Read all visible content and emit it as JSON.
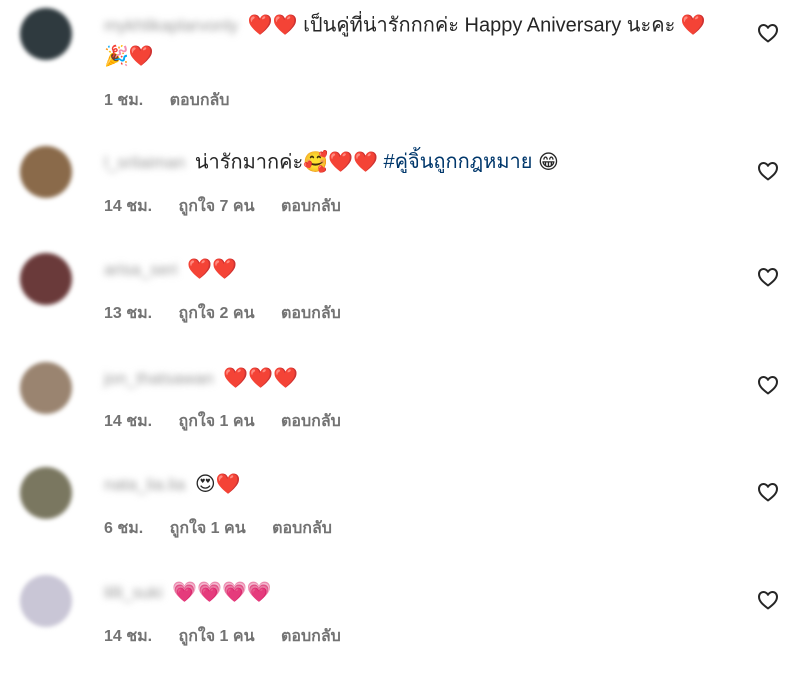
{
  "comments": [
    {
      "username": "mykhlikaplarvonly",
      "avatar_color": "#2f3a3f",
      "text": "❤️❤️ เป็นคู่ที่น่ารักกกค่ะ Happy Aniversary นะคะ ❤️🎉❤️",
      "hashtag": "",
      "time": "1 ชม.",
      "likes": "",
      "reply": "ตอบกลับ"
    },
    {
      "username": "l_srilaiman",
      "avatar_color": "#8a6a4a",
      "text": "น่ารักมากค่ะ🥰❤️❤️ ",
      "hashtag": "#คู่จิ้นถูกกฎหมาย",
      "text_after": " 😁",
      "time": "14 ชม.",
      "likes": "ถูกใจ 7 คน",
      "reply": "ตอบกลับ"
    },
    {
      "username": "arisa_seri",
      "avatar_color": "#6a3a3a",
      "text": "❤️❤️",
      "hashtag": "",
      "time": "13 ชม.",
      "likes": "ถูกใจ 2 คน",
      "reply": "ตอบกลับ"
    },
    {
      "username": "jon_thatsawan",
      "avatar_color": "#9a8470",
      "text": "❤️❤️❤️",
      "hashtag": "",
      "time": "14 ชม.",
      "likes": "ถูกใจ 1 คน",
      "reply": "ตอบกลับ"
    },
    {
      "username": "nata_lia.lia",
      "avatar_color": "#7a7760",
      "text": "😍❤️",
      "hashtag": "",
      "time": "6 ชม.",
      "likes": "ถูกใจ 1 คน",
      "reply": "ตอบกลับ"
    },
    {
      "username": "lilli_suki",
      "avatar_color": "#c9c6d6",
      "text": "💗💗💗💗",
      "hashtag": "",
      "time": "14 ชม.",
      "likes": "ถูกใจ 1 คน",
      "reply": "ตอบกลับ"
    }
  ],
  "icons": {
    "like": "heart-outline-icon"
  }
}
